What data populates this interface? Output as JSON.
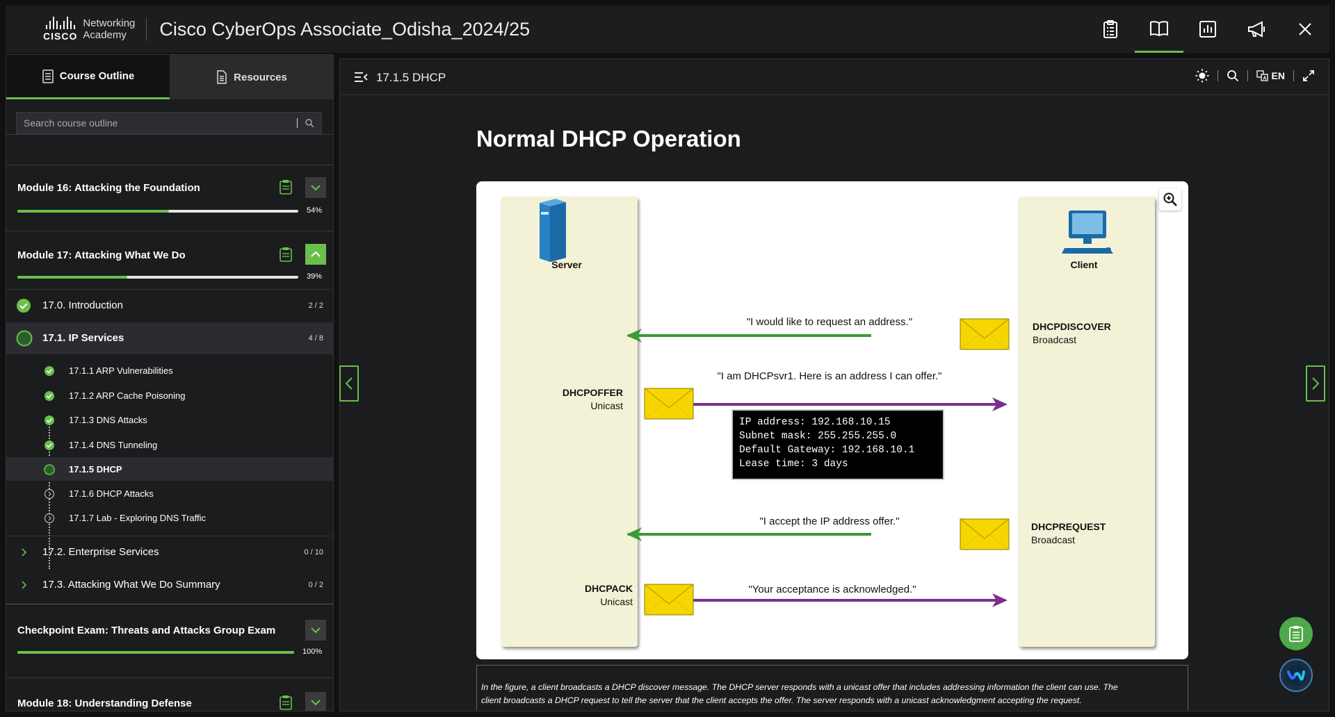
{
  "app": {
    "brand": {
      "logo_word": "CISCO",
      "line1": "Networking",
      "line2": "Academy"
    },
    "course_title": "Cisco CyberOps Associate_Odisha_2024/25",
    "top_icons": [
      "clipboard-icon",
      "book-icon",
      "chart-icon",
      "megaphone-icon",
      "close-icon"
    ]
  },
  "sidebar": {
    "tabs": [
      {
        "label": "Course Outline",
        "active": true
      },
      {
        "label": "Resources",
        "active": false
      }
    ],
    "search_placeholder": "Search course outline",
    "modules": [
      {
        "title": "Module 16: Attacking the Foundation",
        "progress": 54,
        "progress_label": "54%",
        "expanded": false
      },
      {
        "title": "Module 17: Attacking What We Do",
        "progress": 39,
        "progress_label": "39%",
        "expanded": true
      },
      {
        "title": "Checkpoint Exam: Threats and Attacks Group Exam",
        "progress": 100,
        "progress_label": "100%",
        "expanded": false
      },
      {
        "title": "Module 18: Understanding Defense",
        "expanded": false
      }
    ],
    "sections": [
      {
        "label": "17.0. Introduction",
        "count": "2 / 2",
        "status": "complete"
      },
      {
        "label": "17.1. IP Services",
        "count": "4 / 8",
        "status": "in-progress"
      },
      {
        "label": "17.2. Enterprise Services",
        "count": "0 / 10",
        "status": "collapsed"
      },
      {
        "label": "17.3. Attacking What We Do Summary",
        "count": "0 / 2",
        "status": "collapsed"
      }
    ],
    "topics": [
      {
        "label": "17.1.1 ARP Vulnerabilities",
        "status": "complete"
      },
      {
        "label": "17.1.2 ARP Cache Poisoning",
        "status": "complete"
      },
      {
        "label": "17.1.3 DNS Attacks",
        "status": "complete"
      },
      {
        "label": "17.1.4 DNS Tunneling",
        "status": "complete"
      },
      {
        "label": "17.1.5 DHCP",
        "status": "current"
      },
      {
        "label": "17.1.6 DHCP Attacks",
        "status": "not-started"
      },
      {
        "label": "17.1.7 Lab - Exploring DNS Traffic",
        "status": "not-started"
      }
    ]
  },
  "main": {
    "breadcrumb": "17.1.5 DHCP",
    "language": "EN",
    "page_title": "Normal DHCP Operation",
    "figure": {
      "server_label": "Server",
      "client_label": "Client",
      "messages": [
        {
          "quote": "\"I would like to request an address.\"",
          "name": "DHCPDISCOVER",
          "mode": "Broadcast",
          "direction": "client-to-server",
          "color": "#3a9a35"
        },
        {
          "quote": "\"I am DHCPsvr1. Here is an address I can offer.\"",
          "name": "DHCPOFFER",
          "mode": "Unicast",
          "direction": "server-to-client",
          "color": "#7a2e8e"
        },
        {
          "quote": "\"I accept the IP address offer.\"",
          "name": "DHCPREQUEST",
          "mode": "Broadcast",
          "direction": "client-to-server",
          "color": "#3a9a35"
        },
        {
          "quote": "\"Your acceptance is acknowledged.\"",
          "name": "DHCPACK",
          "mode": "Unicast",
          "direction": "server-to-client",
          "color": "#7a2e8e"
        }
      ],
      "offer_details": [
        "IP address: 192.168.10.15",
        "Subnet mask: 255.255.255.0",
        "Default Gateway: 192.168.10.1",
        "Lease time: 3 days"
      ]
    },
    "caption_line1": "In the figure, a client broadcasts a DHCP discover message. The DHCP server responds with a unicast offer that includes addressing information the client can use. The",
    "caption_line2": "client broadcasts a DHCP request to tell the server that the client accepts the offer. The server responds with a unicast acknowledgment accepting the request."
  },
  "colors": {
    "accent": "#6abf4b",
    "broadcast_arrow": "#3a9a35",
    "unicast_arrow": "#7a2e8e",
    "lane": "#f3f2d6"
  }
}
